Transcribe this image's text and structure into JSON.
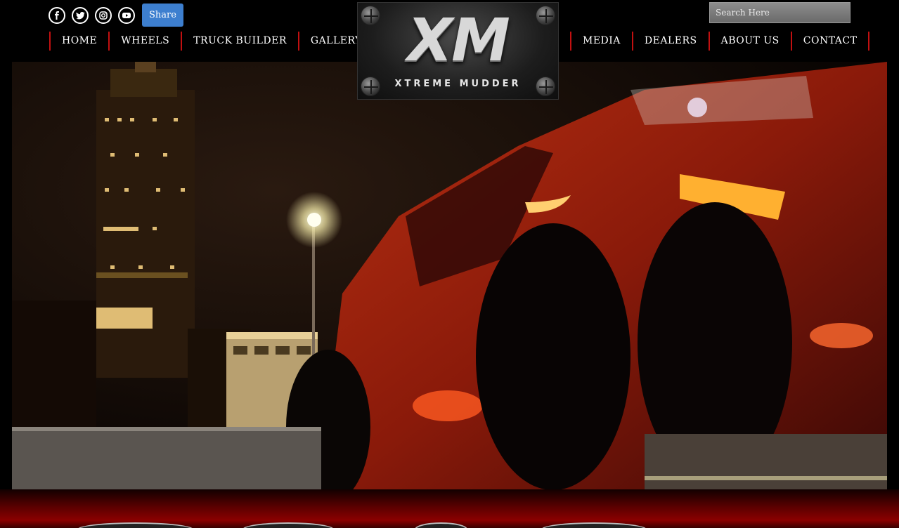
{
  "social": {
    "icons": [
      "facebook-icon",
      "twitter-icon",
      "instagram-icon",
      "youtube-icon"
    ],
    "share_label": "Share"
  },
  "nav": {
    "left": [
      "HOME",
      "WHEELS",
      "TRUCK BUILDER",
      "GALLERY"
    ],
    "right": [
      "MEDIA",
      "DEALERS",
      "ABOUT US",
      "CONTACT"
    ]
  },
  "search": {
    "placeholder": "Search Here"
  },
  "logo": {
    "mark": "XM",
    "tagline": "XTREME MUDDER"
  },
  "colors": {
    "nav_divider": "#c21010",
    "share_bg": "#3d7fcf",
    "band": "#8b0000"
  }
}
